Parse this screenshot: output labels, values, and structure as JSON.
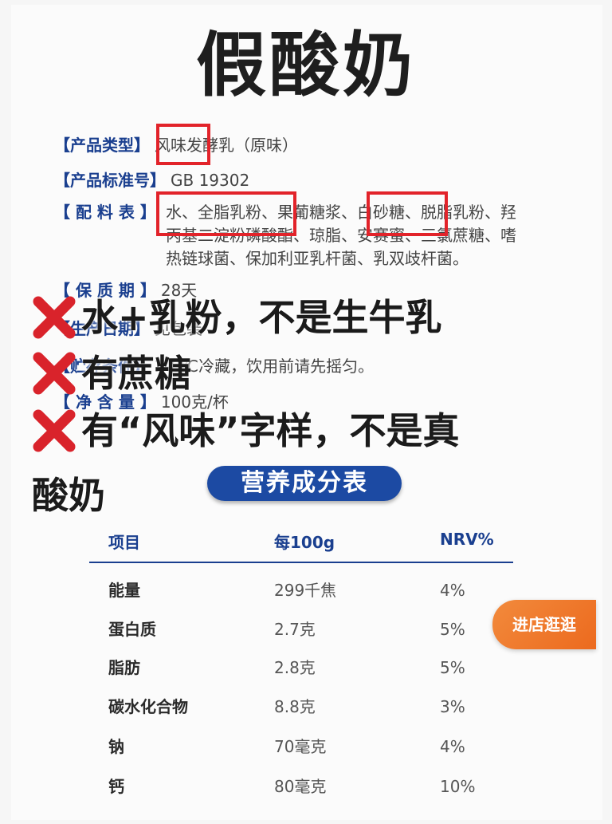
{
  "title": "假酸奶",
  "product": {
    "type_label": "【产品类型】",
    "type_value": "风味发酵乳（原味）",
    "standard_label": "【产品标准号】",
    "standard_value": "GB 19302",
    "ingredients_label": "【 配 料 表 】",
    "ingredients_lines": [
      "水、全脂乳粉、果葡糖浆、白砂糖、脱脂乳粉、羟",
      "丙基二淀粉磷酸酯、琼脂、安赛蜜、三氯蔗糖、嗜",
      "热链球菌、保加利亚乳杆菌、乳双歧杆菌。"
    ],
    "shelf_label": "【 保 质 期 】",
    "shelf_value": "28天",
    "date_label": "【生产日期】",
    "date_value": "见包装",
    "storage_label": "【贮存条件】",
    "storage_value": "2-6℃冷藏，饮用前请先摇匀。",
    "net_label": "【 净 含 量 】",
    "net_value": "100克/杯"
  },
  "overlay": {
    "line1": "水+乳粉，不是生牛乳",
    "line2": "有蔗糖",
    "line3": "有“风味”字样，不是真",
    "line3_cont": "酸奶"
  },
  "nutrition": {
    "title": "营养成分表",
    "headers": [
      "项目",
      "每100g",
      "NRV%"
    ],
    "rows": [
      {
        "name": "能量",
        "value": "299千焦",
        "nrv": "4%"
      },
      {
        "name": "蛋白质",
        "value": "2.7克",
        "nrv": "5%"
      },
      {
        "name": "脂肪",
        "value": "2.8克",
        "nrv": "5%"
      },
      {
        "name": "碳水化合物",
        "value": "8.8克",
        "nrv": "3%"
      },
      {
        "name": "钠",
        "value": "70毫克",
        "nrv": "4%"
      },
      {
        "name": "钙",
        "value": "80毫克",
        "nrv": "10%"
      }
    ]
  },
  "shop_button": "进店逛逛",
  "colors": {
    "accent_blue": "#1c4aa3",
    "red": "#e2232a",
    "orange": "#ec6a1e"
  },
  "icons": [
    "x-mark-icon"
  ]
}
